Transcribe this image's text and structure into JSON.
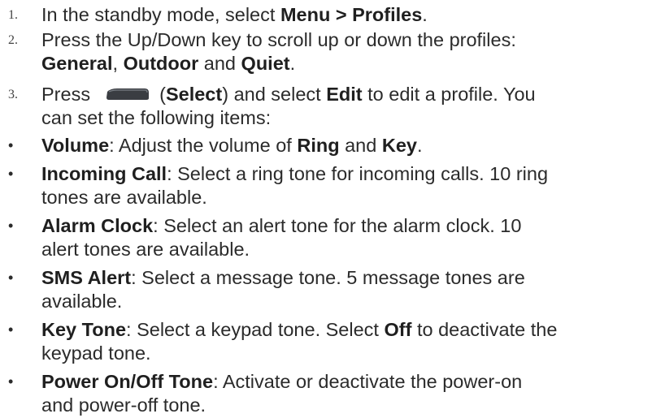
{
  "steps": [
    {
      "marker": "1.",
      "line1": {
        "pre": "In the standby mode, select ",
        "bold": "Menu > Profiles",
        "post": "."
      }
    },
    {
      "marker": "2.",
      "line1": "Press the Up/Down key to scroll up or down the profiles:",
      "line2": {
        "b1": "General",
        "t1": ", ",
        "b2": "Outdoor",
        "t2": " and ",
        "b3": "Quiet",
        "t3": "."
      }
    },
    {
      "marker": "3.",
      "line1": {
        "pre": "Press ",
        "icon": "select-softkey-icon",
        "open": " (",
        "bold1": "Select",
        "mid": ") and select ",
        "bold2": "Edit",
        "post": " to edit a profile. You"
      },
      "line2": "can set the following items:"
    }
  ],
  "bullet_symbol": "•",
  "items": [
    {
      "term": "Volume",
      "line1": {
        "pre": ": Adjust the volume of ",
        "b1": "Ring",
        "mid": " and ",
        "b2": "Key",
        "post": "."
      }
    },
    {
      "term": "Incoming Call",
      "line1": ": Select a ring tone for incoming calls. 10 ring",
      "line2": "tones are available."
    },
    {
      "term": "Alarm Clock",
      "line1": ": Select an alert tone for the alarm clock. 10",
      "line2": "alert tones are available."
    },
    {
      "term": "SMS Alert",
      "line1": ": Select a message tone. 5 message tones are",
      "line2": "available."
    },
    {
      "term": "Key Tone",
      "line1": {
        "pre": ": Select a keypad tone. Select ",
        "b1": "Off",
        "post": " to deactivate the"
      },
      "line2": "keypad tone."
    },
    {
      "term": "Power On/Off Tone",
      "line1": ": Activate or deactivate the power-on",
      "line2": "and power-off tone."
    }
  ],
  "colors": {
    "text": "#2b2b2b",
    "key_icon_body": "#3a3d42",
    "key_icon_highlight": "#7a7f86"
  }
}
